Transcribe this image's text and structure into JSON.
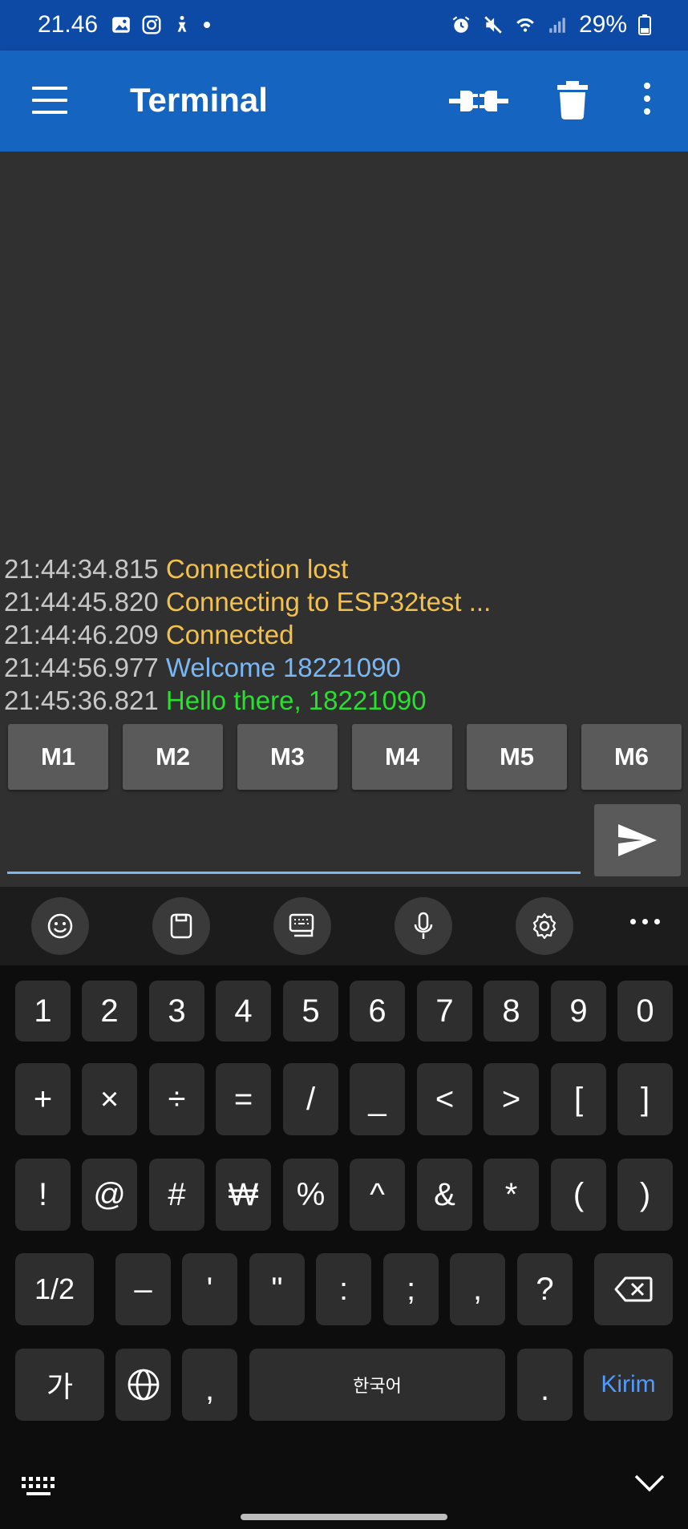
{
  "status_bar": {
    "time": "21.46",
    "battery": "29%",
    "left_icons": [
      "image-icon",
      "instagram-icon",
      "accessibility-icon",
      "dot-icon"
    ],
    "right_icons": [
      "alarm-icon",
      "mute-icon",
      "wifi-icon",
      "signal-icon",
      "battery-icon"
    ]
  },
  "app_bar": {
    "title": "Terminal",
    "icons": [
      "menu-icon",
      "connect-icon",
      "trash-icon",
      "more-vert-icon"
    ]
  },
  "terminal": {
    "lines": [
      {
        "time": "21:44:34.815",
        "text": "Connection lost",
        "kind": "status"
      },
      {
        "time": "21:44:45.820",
        "text": "Connecting to ESP32test ...",
        "kind": "status"
      },
      {
        "time": "21:44:46.209",
        "text": "Connected",
        "kind": "status"
      },
      {
        "time": "21:44:56.977",
        "text": "Welcome 18221090",
        "kind": "received"
      },
      {
        "time": "21:45:36.821",
        "text": "Hello there, 18221090",
        "kind": "sent"
      }
    ],
    "macros": [
      "M1",
      "M2",
      "M3",
      "M4",
      "M5",
      "M6"
    ],
    "input_value": "",
    "send_icon": "send-icon"
  },
  "keyboard": {
    "toolbar": [
      "emoji-icon",
      "clipboard-icon",
      "keyboard-mode-icon",
      "mic-icon",
      "settings-icon",
      "more-horiz-icon"
    ],
    "row1": [
      "1",
      "2",
      "3",
      "4",
      "5",
      "6",
      "7",
      "8",
      "9",
      "0"
    ],
    "row2": [
      "+",
      "×",
      "÷",
      "=",
      "/",
      "_",
      "<",
      ">",
      "[",
      "]"
    ],
    "row3": [
      "!",
      "@",
      "#",
      "₩",
      "%",
      "^",
      "&",
      "*",
      "(",
      ")"
    ],
    "row4": [
      "1/2",
      "–",
      "'",
      "\"",
      ":",
      ";",
      ",",
      "?"
    ],
    "row5": {
      "lang": "가",
      "comma": ",",
      "space": "한국어",
      "period": ".",
      "action": "Kirim"
    }
  },
  "colors": {
    "status_bar": "#0d4aa6",
    "app_bar": "#1565c0",
    "terminal_bg": "#303030",
    "status_text": "#f2c14e",
    "received_text": "#7ab8f5",
    "sent_text": "#29e02f",
    "action_text": "#4f9bff"
  }
}
